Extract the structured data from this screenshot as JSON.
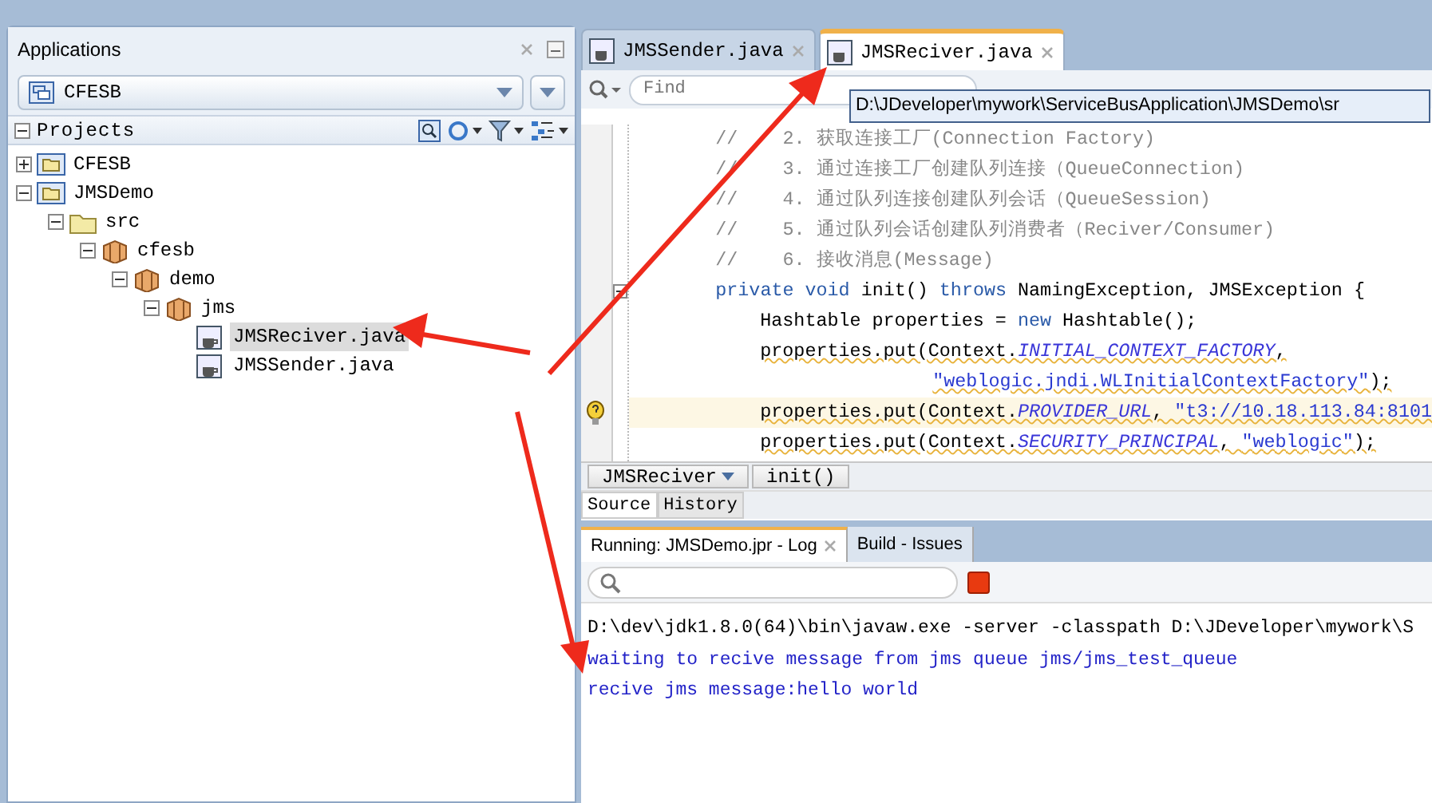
{
  "explorer": {
    "title": "Applications",
    "application": "CFESB",
    "section": "Projects",
    "section_expanded": true,
    "tree": [
      {
        "label": "CFESB",
        "kind": "project",
        "expanded": false,
        "selected": false
      },
      {
        "label": "JMSDemo",
        "kind": "project",
        "expanded": true,
        "selected": false,
        "children": [
          {
            "label": "src",
            "kind": "folder",
            "expanded": true,
            "selected": false,
            "children": [
              {
                "label": "cfesb",
                "kind": "package",
                "expanded": true,
                "selected": false,
                "children": [
                  {
                    "label": "demo",
                    "kind": "package",
                    "expanded": true,
                    "selected": false,
                    "children": [
                      {
                        "label": "jms",
                        "kind": "package",
                        "expanded": true,
                        "selected": false,
                        "children": [
                          {
                            "label": "JMSReciver.java",
                            "kind": "java",
                            "selected": true
                          },
                          {
                            "label": "JMSSender.java",
                            "kind": "java",
                            "selected": false
                          }
                        ]
                      }
                    ]
                  }
                ]
              }
            ]
          }
        ]
      }
    ]
  },
  "editor": {
    "tabs": [
      {
        "label": "JMSSender.java",
        "selected": false
      },
      {
        "label": "JMSReciver.java",
        "selected": true
      }
    ],
    "find": {
      "placeholder": "Find"
    },
    "tooltip": "D:\\JDeveloper\\mywork\\ServiceBusApplication\\JMSDemo\\sr",
    "lines": [
      {
        "kind": "member",
        "warning": false,
        "current": false,
        "fold": false,
        "hint": false,
        "segments": [
          {
            "kind": "comment",
            "text": "//    2. 获取连接工厂(Connection Factory)"
          }
        ]
      },
      {
        "kind": "member",
        "warning": false,
        "current": false,
        "fold": false,
        "hint": false,
        "segments": [
          {
            "kind": "comment",
            "text": "//    3. 通过连接工厂创建队列连接（QueueConnection)"
          }
        ]
      },
      {
        "kind": "member",
        "warning": false,
        "current": false,
        "fold": false,
        "hint": false,
        "segments": [
          {
            "kind": "comment",
            "text": "//    4. 通过队列连接创建队列会话（QueueSession)"
          }
        ]
      },
      {
        "kind": "member",
        "warning": false,
        "current": false,
        "fold": false,
        "hint": false,
        "segments": [
          {
            "kind": "comment",
            "text": "//    5. 通过队列会话创建队列消费者（Reciver/Consumer)"
          }
        ]
      },
      {
        "kind": "member",
        "warning": false,
        "current": false,
        "fold": false,
        "hint": false,
        "segments": [
          {
            "kind": "comment",
            "text": "//    6. 接收消息(Message)"
          }
        ]
      },
      {
        "kind": "member",
        "warning": false,
        "current": false,
        "fold": true,
        "hint": false,
        "segments": [
          {
            "kind": "keyword",
            "text": "private void"
          },
          {
            "kind": "plain",
            "text": " init() "
          },
          {
            "kind": "keyword",
            "text": "throws"
          },
          {
            "kind": "plain",
            "text": " NamingException, JMSException {"
          }
        ]
      },
      {
        "kind": "body",
        "warning": false,
        "current": false,
        "fold": false,
        "hint": false,
        "segments": [
          {
            "kind": "plain",
            "text": "Hashtable properties = "
          },
          {
            "kind": "keyword",
            "text": "new"
          },
          {
            "kind": "plain",
            "text": " Hashtable();"
          }
        ]
      },
      {
        "kind": "body",
        "warning": true,
        "current": false,
        "fold": false,
        "hint": false,
        "segments": [
          {
            "kind": "plain",
            "text": "properties.put(Context."
          },
          {
            "kind": "field",
            "text": "INITIAL_CONTEXT_FACTORY"
          },
          {
            "kind": "plain",
            "text": ","
          }
        ]
      },
      {
        "kind": "continuation",
        "warning": true,
        "current": false,
        "fold": false,
        "hint": false,
        "segments": [
          {
            "kind": "string",
            "text": "\"weblogic.jndi.WLInitialContextFactory\""
          },
          {
            "kind": "plain",
            "text": ");"
          }
        ]
      },
      {
        "kind": "body",
        "warning": true,
        "current": true,
        "fold": false,
        "hint": true,
        "segments": [
          {
            "kind": "plain",
            "text": "properties.put(Context."
          },
          {
            "kind": "field",
            "text": "PROVIDER_URL"
          },
          {
            "kind": "plain",
            "text": ", "
          },
          {
            "kind": "string",
            "text": "\"t3://10.18.113.84:8101"
          }
        ]
      },
      {
        "kind": "body",
        "warning": true,
        "current": false,
        "fold": false,
        "hint": false,
        "segments": [
          {
            "kind": "plain",
            "text": "properties.put(Context."
          },
          {
            "kind": "field",
            "text": "SECURITY_PRINCIPAL"
          },
          {
            "kind": "plain",
            "text": ", "
          },
          {
            "kind": "string",
            "text": "\"weblogic\""
          },
          {
            "kind": "plain",
            "text": ");"
          }
        ]
      }
    ],
    "breadcrumb": [
      {
        "label": "JMSReciver",
        "dropdown": true
      },
      {
        "label": "init()",
        "dropdown": false
      }
    ],
    "view_tabs": [
      {
        "label": "Source",
        "selected": true
      },
      {
        "label": "History",
        "selected": false
      }
    ]
  },
  "log": {
    "tabs": [
      {
        "label": "Running: JMSDemo.jpr - Log",
        "selected": true,
        "closable": true
      },
      {
        "label": "Build - Issues",
        "selected": false,
        "closable": false
      }
    ],
    "lines": [
      {
        "kind": "command",
        "text": "D:\\dev\\jdk1.8.0(64)\\bin\\javaw.exe -server -classpath D:\\JDeveloper\\mywork\\S"
      },
      {
        "kind": "output",
        "text": "waiting to recive message from jms queue jms/jms_test_queue"
      },
      {
        "kind": "output",
        "text": "recive jms message:hello world"
      }
    ]
  }
}
